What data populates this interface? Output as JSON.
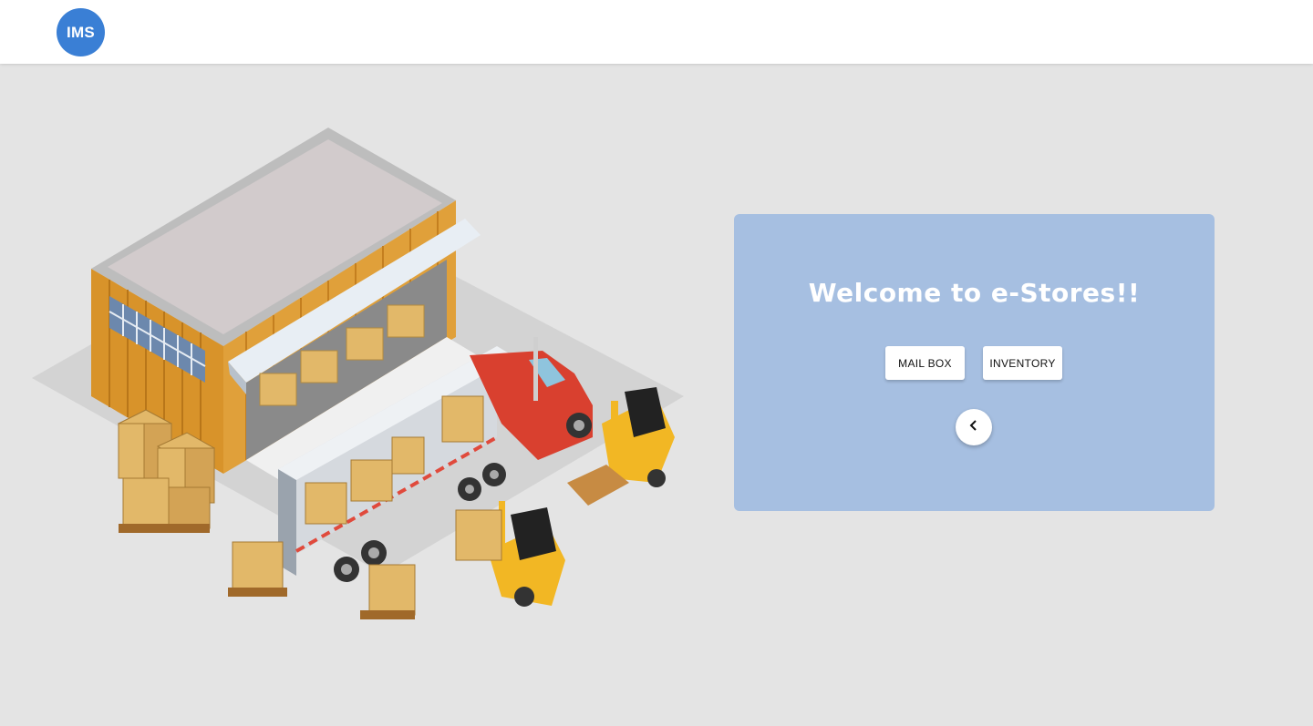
{
  "header": {
    "logo_text": "IMS"
  },
  "hero": {
    "illustration": "warehouse-loading-dock-illustration"
  },
  "card": {
    "welcome_text": "Welcome to e-Stores!!",
    "mailbox_label": "MAIL BOX",
    "inventory_label": "INVENTORY",
    "back_icon": "chevron-left-icon"
  },
  "colors": {
    "logo_bg": "#3a7fd5",
    "card_bg": "#a6bfe1",
    "page_bg": "#e4e4e4"
  }
}
